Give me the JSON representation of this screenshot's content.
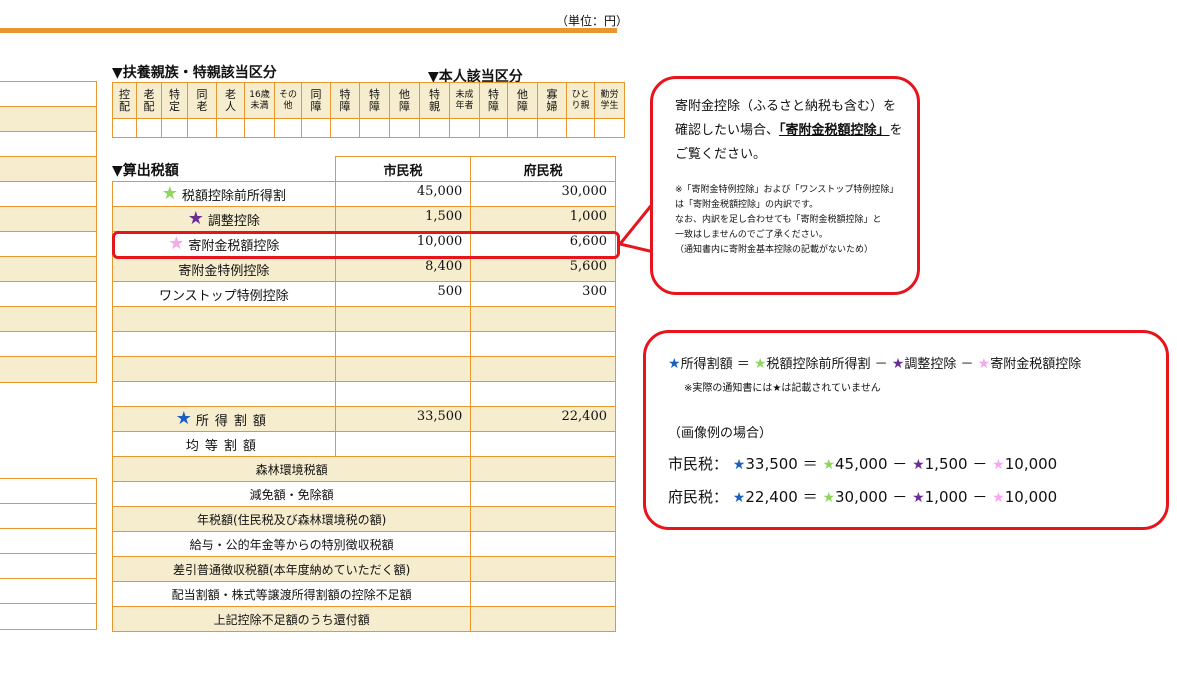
{
  "unit_label": "（単位：円）",
  "sections": {
    "dependents": "▼扶養親族・特親該当区分",
    "self": "▼本人該当区分",
    "tax_calc": "▼算出税額"
  },
  "category_headers": [
    "控配",
    "老配",
    "特定",
    "同老",
    "老人",
    "16歳未満",
    "その他",
    "同障",
    "特障",
    "特障",
    "他障",
    "特親",
    "未成年者",
    "特障",
    "他障",
    "寡婦",
    "ひとり親",
    "勤労学生"
  ],
  "tax_table": {
    "col_city": "市民税",
    "col_pref": "府民税",
    "rows": [
      {
        "label": "税額控除前所得割",
        "city": "45,000",
        "pref": "30,000"
      },
      {
        "label": "調整控除",
        "city": "1,500",
        "pref": "1,000"
      },
      {
        "label": "寄附金税額控除",
        "city": "10,000",
        "pref": "6,600"
      },
      {
        "label": "寄附金特例控除",
        "city": "8,400",
        "pref": "5,600"
      },
      {
        "label": "ワンストップ特例控除",
        "city": "500",
        "pref": "300"
      },
      {
        "label": "所得割額",
        "city": "33,500",
        "pref": "22,400"
      },
      {
        "label": "均等割額",
        "city": "",
        "pref": ""
      }
    ],
    "bottom_rows": [
      "森林環境税額",
      "減免額・免除額",
      "年税額(住民税及び森林環境税の額)",
      "給与・公的年金等からの特別徴収税額",
      "差引普通徴収税額(本年度納めていただく額)",
      "配当割額・株式等譲渡所得割額の控除不足額",
      "上記控除不足額のうち還付額"
    ]
  },
  "callout1": {
    "line1": "寄附金控除（ふるさと納税も含む）を",
    "line2_pre": "確認したい場合、",
    "line2_bold": "「寄附金税額控除」",
    "line2_post": "を",
    "line3": "ご覧ください。",
    "note1": "※「寄附金特例控除」および「ワンストップ特例控除」",
    "note2": "は「寄附金税額控除」の内訳です。",
    "note3": "なお、内訳を足し合わせても「寄附金税額控除」と",
    "note4": "一致はしませんのでご了承ください。",
    "note5": "（通知書内に寄附金基本控除の記載がないため）"
  },
  "callout2": {
    "formula_t1": "所得割額",
    "formula_eq": "＝",
    "formula_t2": "税額控除前所得割",
    "formula_minus": "－",
    "formula_t3": "調整控除",
    "formula_t4": "寄附金税額控除",
    "note": "※実際の通知書には★は記載されていません",
    "example_title": "（画像例の場合）",
    "city_label": "市民税：",
    "city_values": [
      "33,500",
      "45,000",
      "1,500",
      "10,000"
    ],
    "pref_label": "府民税：",
    "pref_values": [
      "22,400",
      "30,000",
      "1,000",
      "10,000"
    ],
    "eq": "＝",
    "minus": "－"
  },
  "colors": {
    "accent": "#e8962e",
    "highlight": "#e8141b",
    "tan": "#f6edce",
    "green_star": "#8fd65e",
    "purple_star": "#6b2c96",
    "pink_star": "#f7a6f2",
    "blue_star": "#1b5fbf"
  }
}
